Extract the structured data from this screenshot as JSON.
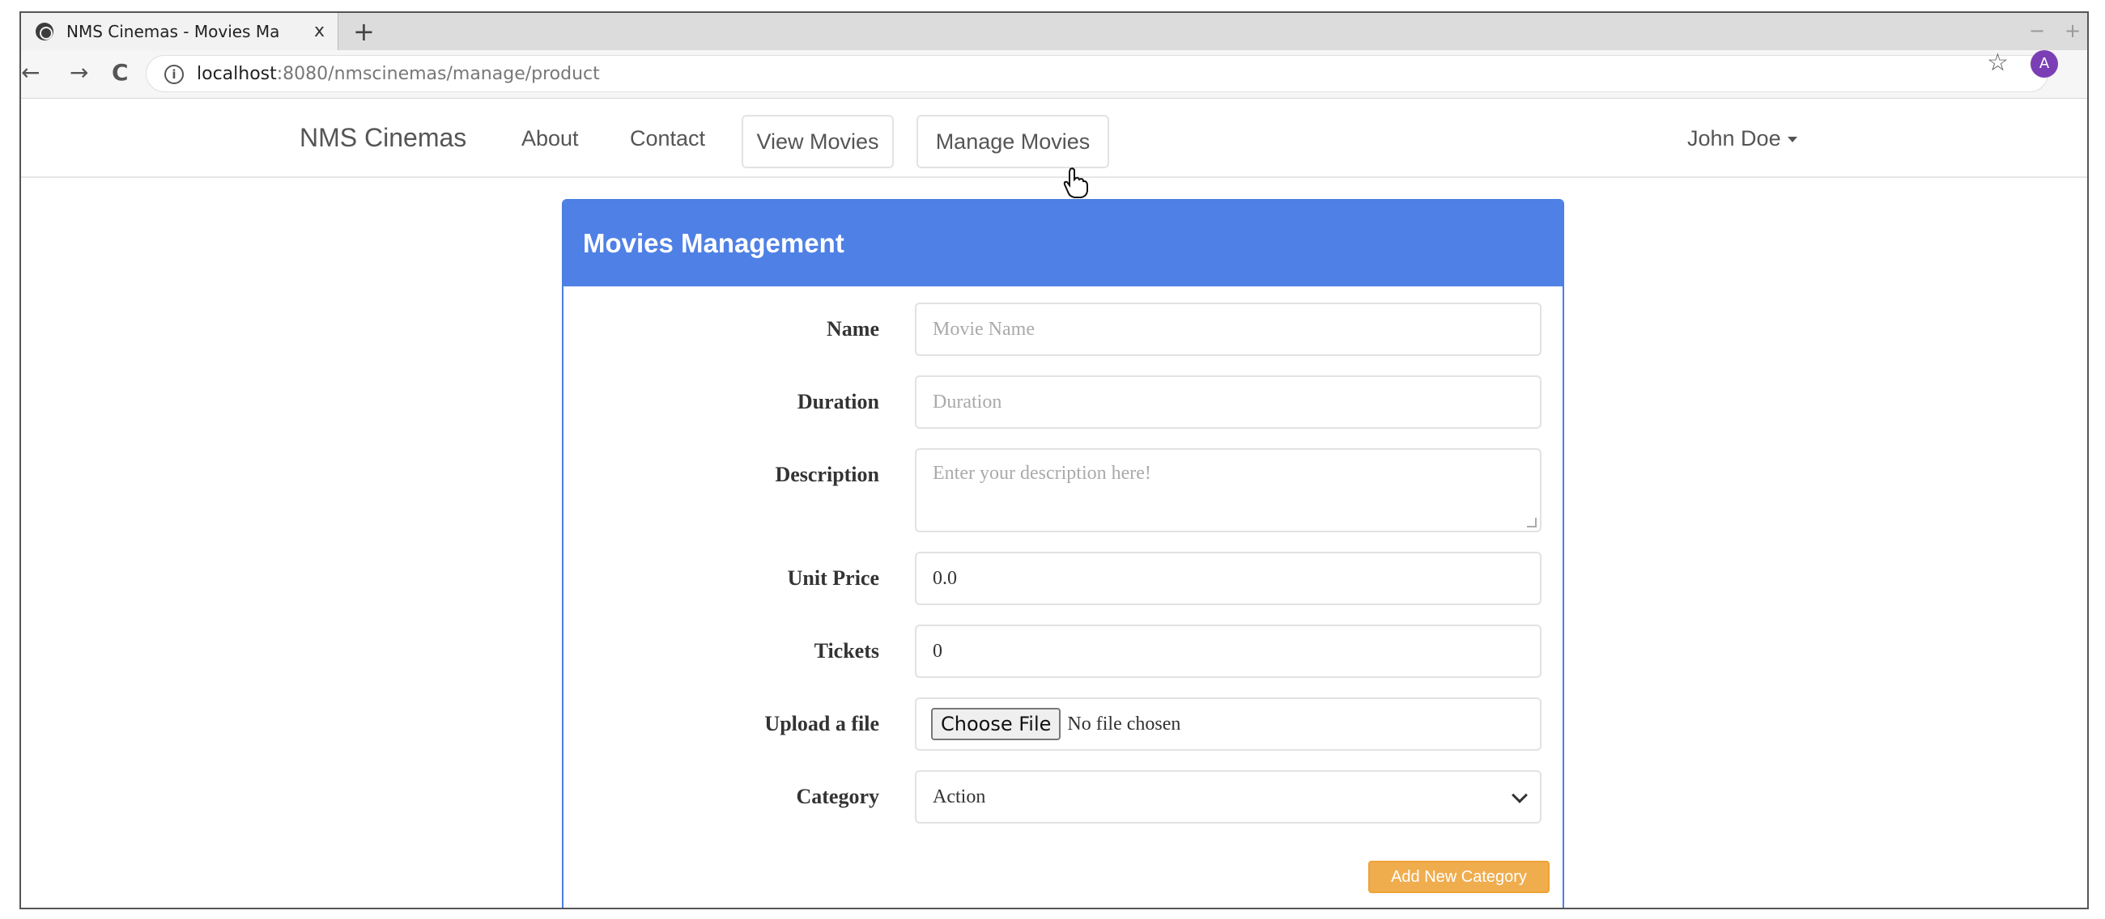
{
  "browser": {
    "tab_title": "NMS Cinemas - Movies Ma",
    "tab_close": "x",
    "new_tab": "+",
    "url_host": "localhost",
    "url_path": ":8080/nmscinemas/manage/product",
    "info_glyph": "i",
    "profile_initial": "A",
    "window_minimize": "−",
    "window_close": "+"
  },
  "navbar": {
    "brand": "NMS Cinemas",
    "links": [
      "About",
      "Contact"
    ],
    "buttons": [
      "View Movies",
      "Manage Movies"
    ],
    "user": "John Doe"
  },
  "panel": {
    "title": "Movies Management"
  },
  "form": {
    "name_label": "Name",
    "name_placeholder": "Movie Name",
    "duration_label": "Duration",
    "duration_placeholder": "Duration",
    "description_label": "Description",
    "description_placeholder": "Enter your description here!",
    "unit_price_label": "Unit Price",
    "unit_price_value": "0.0",
    "tickets_label": "Tickets",
    "tickets_value": "0",
    "upload_label": "Upload a file",
    "choose_file_button": "Choose File",
    "file_status": "No file chosen",
    "category_label": "Category",
    "category_value": "Action",
    "add_category_button": "Add New Category"
  },
  "icons": {
    "favicon": "globe-icon",
    "back": "back-arrow-icon",
    "forward": "forward-arrow-icon",
    "reload": "reload-icon",
    "info": "info-icon",
    "bookmark": "star-icon",
    "cursor": "hand-cursor-icon"
  },
  "colors": {
    "panel_header": "#4f80e5",
    "add_category": "#f0ad4e",
    "profile": "#7b3fb5"
  }
}
